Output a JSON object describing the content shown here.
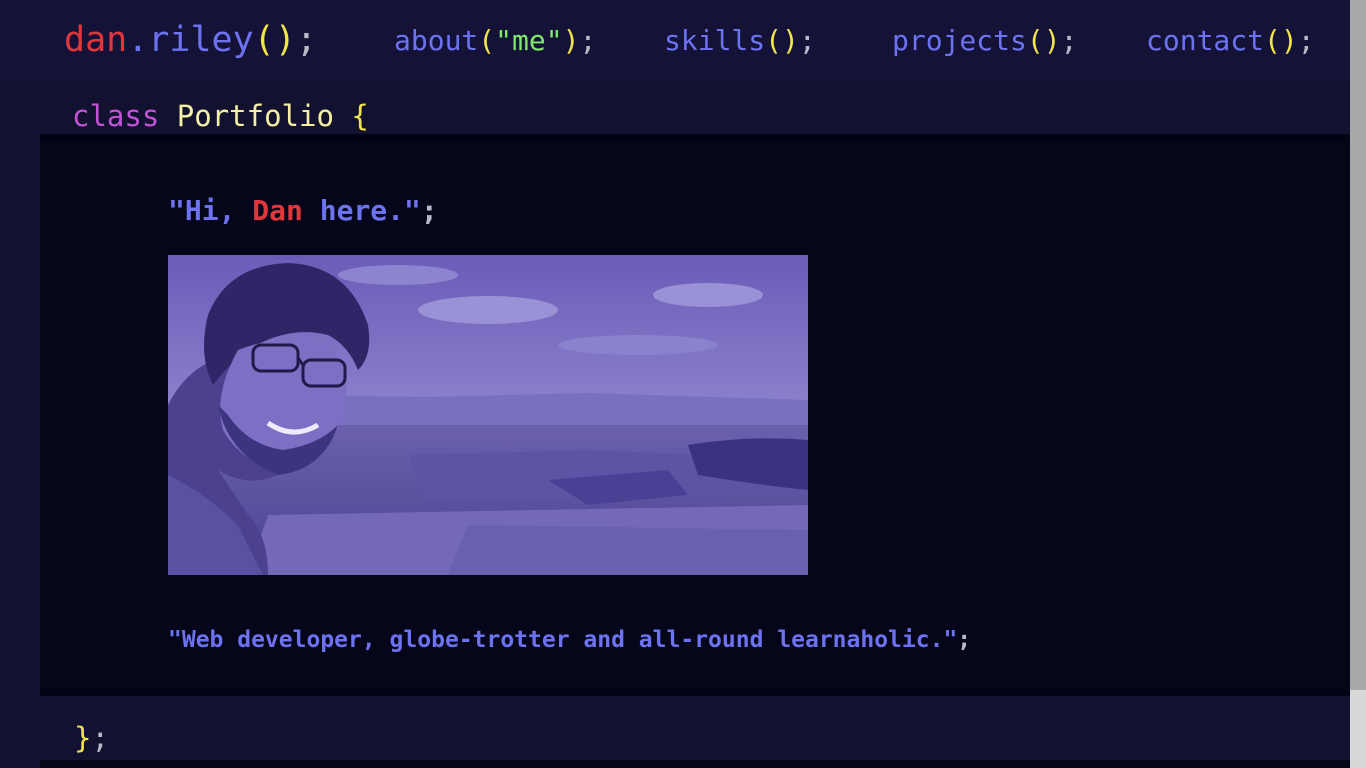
{
  "brand": {
    "first": "dan",
    "dot": ".",
    "last": "riley",
    "parens": "()",
    "semi": ";"
  },
  "nav": {
    "about": {
      "name": "about",
      "open": "(",
      "arg": "\"me\"",
      "close": ")",
      "semi": ";"
    },
    "skills": {
      "name": "skills",
      "parens": "()",
      "semi": ";"
    },
    "projects": {
      "name": "projects",
      "parens": "()",
      "semi": ";"
    },
    "contact": {
      "name": "contact",
      "parens": "()",
      "semi": ";"
    }
  },
  "class_decl": {
    "keyword": "class",
    "name": "Portfolio",
    "brace": "{"
  },
  "greeting": {
    "quote_open": "\"Hi, ",
    "name": "Dan",
    "rest": " here.\"",
    "semi": ";"
  },
  "tagline": {
    "text": "\"Web developer, globe-trotter and all-round learnaholic.\"",
    "semi": ";"
  },
  "close": {
    "brace": "}",
    "semi": ";"
  },
  "colors": {
    "background": "#12112f",
    "nav_background": "#141337",
    "block_background": "#05061a",
    "red": "#e0363c",
    "blue": "#6d72f1",
    "yellow": "#f2e54b",
    "green": "#7ee86a",
    "magenta": "#c153d6",
    "photo_tint": "#6a5fb2"
  }
}
